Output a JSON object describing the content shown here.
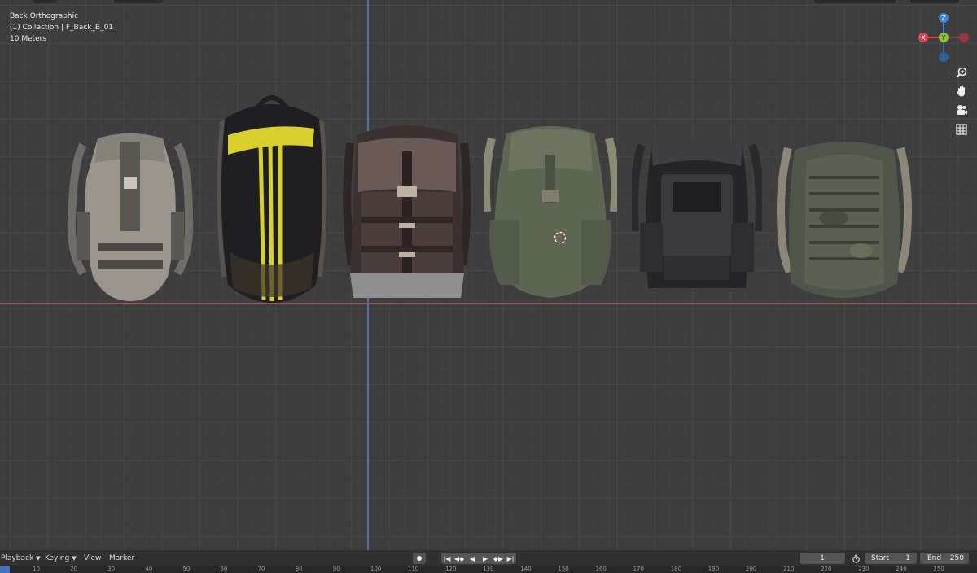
{
  "viewport": {
    "view_name": "Back Orthographic",
    "collection_line": "(1) Collection | F_Back_B_01",
    "scale_line": "10 Meters",
    "gizmo_labels": {
      "z": "Z",
      "y": "Y",
      "x": "X"
    },
    "nav_icons": [
      "zoom-icon",
      "hand-pan-icon",
      "camera-icon",
      "grid-icon"
    ],
    "objects": [
      "backpack-1",
      "backpack-2",
      "backpack-3",
      "backpack-4",
      "backpack-5",
      "backpack-6"
    ]
  },
  "timeline": {
    "playback": "Playback",
    "keying": "Keying",
    "view": "View",
    "marker": "Marker",
    "current_frame": "1",
    "start_label": "Start",
    "start_value": "1",
    "end_label": "End",
    "end_value": "250",
    "ruler_ticks": [
      "10",
      "20",
      "30",
      "40",
      "50",
      "60",
      "70",
      "80",
      "90",
      "100",
      "110",
      "120",
      "130",
      "140",
      "150",
      "160",
      "170",
      "180",
      "190",
      "200",
      "210",
      "220",
      "230",
      "240",
      "250"
    ]
  },
  "colors": {
    "axis_x": "#c0424f",
    "axis_z": "#4d7bd1",
    "gizmo_x": "#e0404f",
    "gizmo_y": "#8bc531",
    "gizmo_z": "#3f86d8"
  }
}
